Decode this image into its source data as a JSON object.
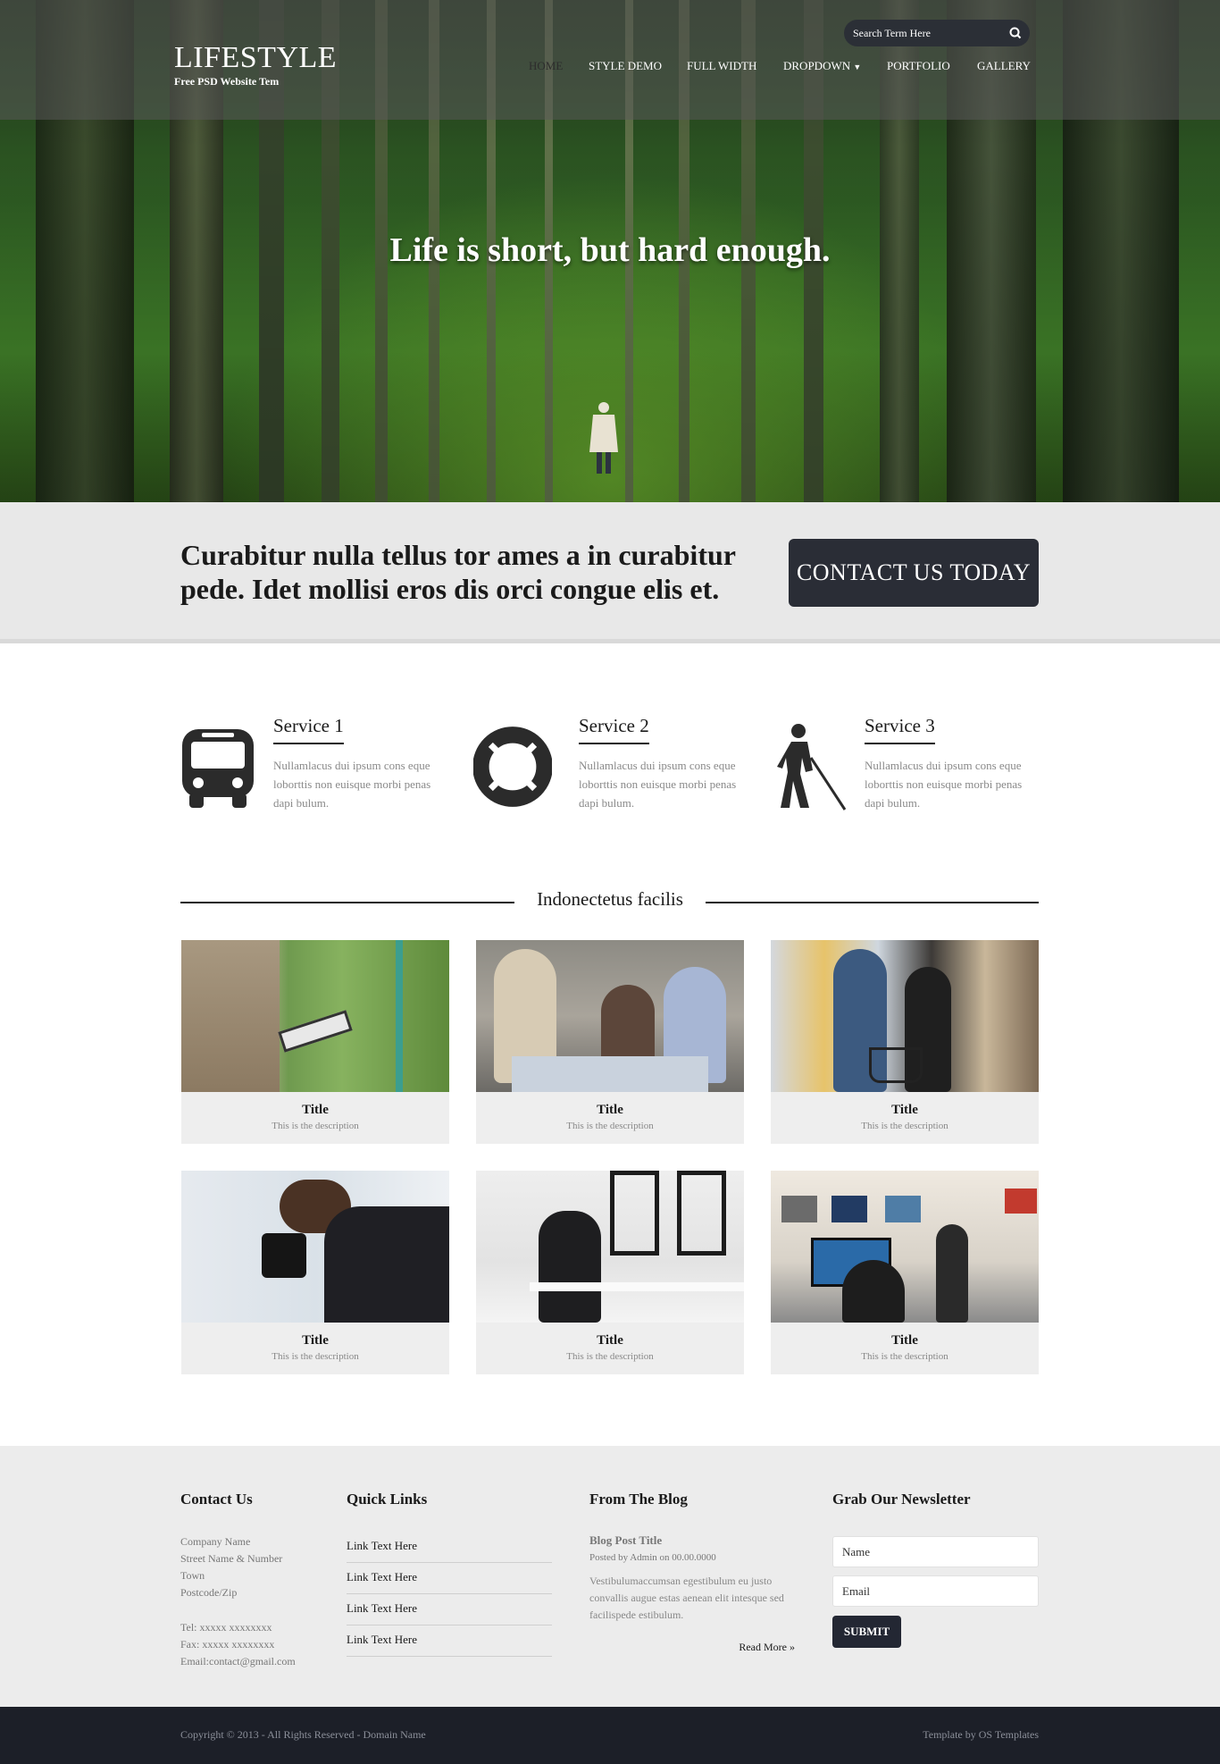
{
  "header": {
    "logo_title": "LIFESTYLE",
    "logo_subtitle": "Free PSD Website Tem",
    "search_placeholder": "Search Term Here",
    "nav": [
      "HOME",
      "STYLE DEMO",
      "FULL WIDTH",
      "DROPDOWN",
      "PORTFOLIO",
      "GALLERY"
    ],
    "active_nav": "HOME"
  },
  "hero": {
    "tagline": "Life is short, but hard enough."
  },
  "cta": {
    "text": "Curabitur nulla tellus tor ames a in curabitur pede. Idet mollisi eros dis orci congue elis et.",
    "button_label": "CONTACT US TODAY"
  },
  "services": [
    {
      "title": "Service 1",
      "icon": "bus-icon",
      "description": "Nullamlacus dui ipsum cons eque loborttis non euisque morbi penas dapi bulum."
    },
    {
      "title": "Service 2",
      "icon": "lifebuoy-icon",
      "description": "Nullamlacus dui ipsum cons eque loborttis non euisque morbi penas dapi bulum."
    },
    {
      "title": "Service 3",
      "icon": "blind-person-icon",
      "description": "Nullamlacus dui ipsum cons eque loborttis non euisque morbi penas dapi bulum."
    }
  ],
  "gallery": {
    "heading": "Indonectetus facilis",
    "items": [
      {
        "title": "Title",
        "description": "This is the description"
      },
      {
        "title": "Title",
        "description": "This is the description"
      },
      {
        "title": "Title",
        "description": "This is the description"
      },
      {
        "title": "Title",
        "description": "This is the description"
      },
      {
        "title": "Title",
        "description": "This is the description"
      },
      {
        "title": "Title",
        "description": "This is the description"
      }
    ]
  },
  "footer": {
    "contact": {
      "heading": "Contact Us",
      "address": [
        "Company Name",
        "Street Name & Number",
        "Town",
        "Postcode/Zip"
      ],
      "tel": "Tel: xxxxx xxxxxxxx",
      "fax": "Fax: xxxxx xxxxxxxx",
      "email": "Email:contact@gmail.com"
    },
    "quick_links": {
      "heading": "Quick Links",
      "links": [
        "Link Text Here",
        "Link Text Here",
        "Link Text Here",
        "Link Text Here"
      ]
    },
    "blog": {
      "heading": "From The Blog",
      "post_title": "Blog Post Title",
      "meta": "Posted by Admin on 00.00.0000",
      "body": "Vestibulumaccumsan egestibulum eu justo convallis augue estas aenean elit intesque sed facilispede estibulum.",
      "read_more": "Read More »"
    },
    "newsletter": {
      "heading": "Grab Our Newsletter",
      "name_placeholder": "Name",
      "email_placeholder": "Email",
      "submit_label": "SUBMIT"
    },
    "copyright": "Copyright © 2013 - All Rights Reserved - Domain Name",
    "credit": "Template by OS Templates"
  },
  "colors": {
    "dark_button": "#2a2d36",
    "cta_band": "#e8e8e8",
    "footer_bg": "#ececec",
    "bottom_bar": "#1c1f28"
  }
}
